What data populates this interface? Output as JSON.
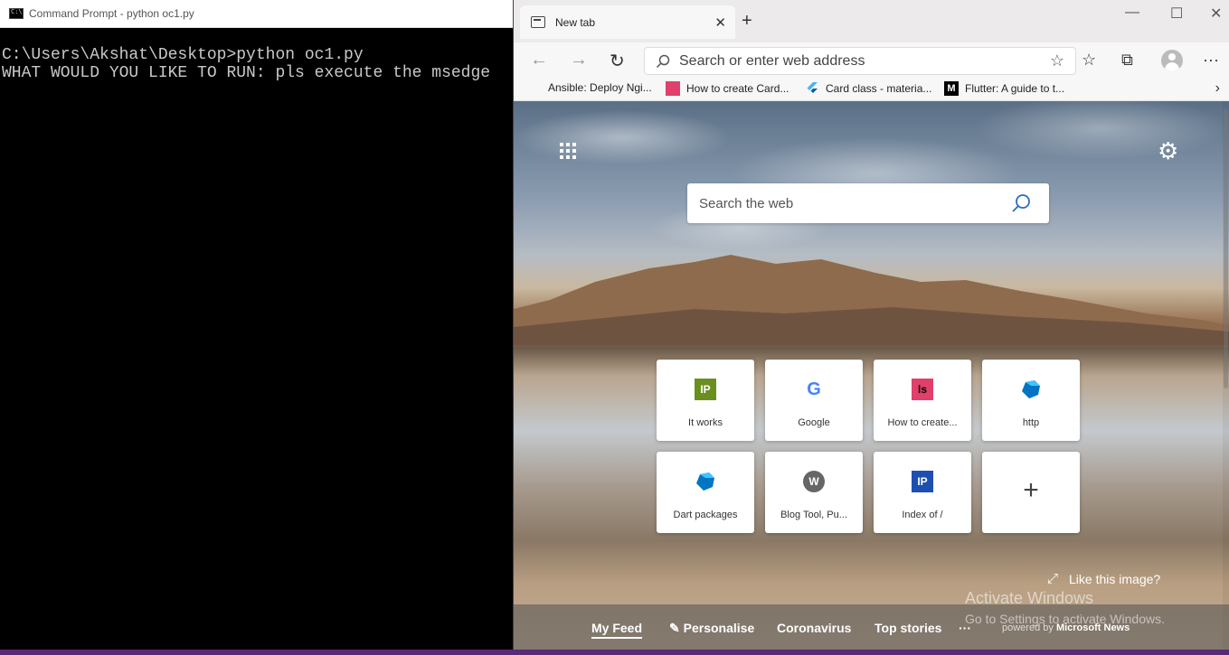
{
  "cmd": {
    "title": "Command Prompt - python  oc1.py",
    "lines": [
      "C:\\Users\\Akshat\\Desktop>python oc1.py",
      "WHAT WOULD YOU LIKE TO RUN: pls execute the msedge"
    ]
  },
  "edge": {
    "tab_label": "New tab",
    "new_tab": "+",
    "address_placeholder": "Search or enter web address",
    "favorites": [
      {
        "label": "Ansible: Deploy Ngi..."
      },
      {
        "label": "How to create Card..."
      },
      {
        "label": "Card class - materia..."
      },
      {
        "label": "Flutter: A guide to t..."
      }
    ],
    "search_placeholder": "Search the web",
    "tiles": [
      {
        "label": "It works",
        "icon": "IP",
        "icon_color": "#6b8f1f"
      },
      {
        "label": "Google",
        "icon": "G",
        "icon_color": "#4285f4"
      },
      {
        "label": "How to create...",
        "icon": "ls",
        "icon_color": "#e0406b"
      },
      {
        "label": "http",
        "icon": "dart",
        "icon_color": "#0175c2"
      },
      {
        "label": "Dart packages",
        "icon": "dart",
        "icon_color": "#0175c2"
      },
      {
        "label": "Blog Tool, Pu...",
        "icon": "W",
        "icon_color": "#555555"
      },
      {
        "label": "Index of /",
        "icon": "IP",
        "icon_color": "#1c4fb0"
      },
      {
        "label": "",
        "icon": "+",
        "icon_color": "#444444"
      }
    ],
    "like_image": "Like this image?",
    "feed": {
      "my_feed": "My Feed",
      "personalise": "Personalise",
      "coronavirus": "Coronavirus",
      "top_stories": "Top stories",
      "more": "···",
      "powered_by": "powered by",
      "brand": "Microsoft News"
    },
    "watermark_title": "Activate Windows",
    "watermark_sub": "Go to Settings to activate Windows."
  }
}
